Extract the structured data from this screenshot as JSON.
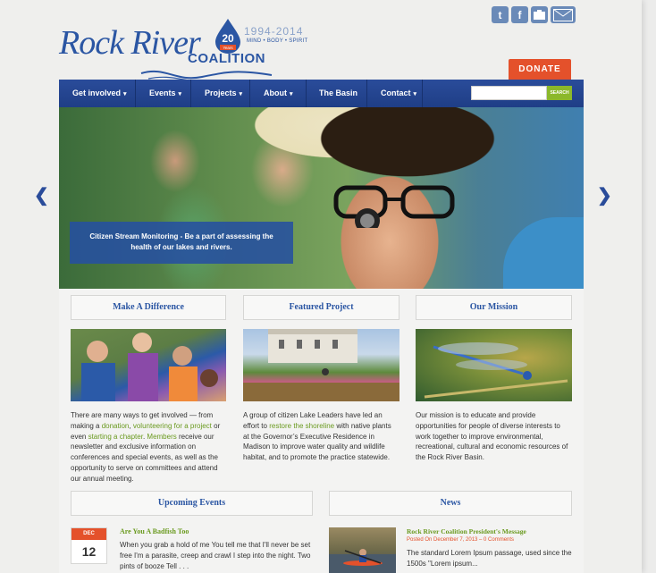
{
  "brand": {
    "script_name": "Rock River",
    "anniversary_number": "20",
    "anniversary_label": "Years",
    "years": "1994-2014",
    "motto": "MIND • BODY • SPIRIT",
    "coalition": "COALITION",
    "colors": {
      "blue": "#2b56a3",
      "orange": "#e4512b",
      "green": "#6a9a1f"
    }
  },
  "social": {
    "twitter_glyph": "t",
    "facebook_glyph": "f",
    "icons": [
      "twitter-icon",
      "facebook-icon",
      "flickr-icon",
      "mail-icon"
    ]
  },
  "donate_label": "DONATE",
  "nav": {
    "items": [
      {
        "label": "Get involved",
        "caret": "▾"
      },
      {
        "label": "Events",
        "caret": "▾"
      },
      {
        "label": "Projects",
        "caret": "▾"
      },
      {
        "label": "About",
        "caret": "▾"
      },
      {
        "label": "The Basin",
        "caret": ""
      },
      {
        "label": "Contact",
        "caret": "▾"
      }
    ],
    "search_placeholder": "",
    "search_button": "SEARCH"
  },
  "hero": {
    "caption": "Citizen Stream Monitoring - Be a part of assessing the health of our lakes and rivers.",
    "prev_arrow": "❮",
    "next_arrow": "❯"
  },
  "columns": [
    {
      "heading": "Make A Difference",
      "text_parts": {
        "t1": "There are many ways to get involved — from making a ",
        "l1": "donation",
        "t2": ", ",
        "l2": "volunteering for a project",
        "t3": " or even ",
        "l3": "starting a chapter",
        "t4": ". ",
        "l4": "Members",
        "t5": " receive our newsletter and exclusive information on conferences and special events, as well as the opportunity to serve on committees and attend our annual meeting."
      }
    },
    {
      "heading": "Featured Project",
      "text_parts": {
        "t1": "A group of citizen Lake Leaders have led an effort to ",
        "l1": "restore the shoreline",
        "t2": " with native plants at the Governor’s Executive Residence in Madison to improve water quality and wildlife habitat, and to promote the practice statewide."
      }
    },
    {
      "heading": "Our Mission",
      "text": "Our mission is to educate and provide opportunities for people of diverse interests to work together to improve environmental, recreational, cultural and economic resources of the Rock River Basin."
    }
  ],
  "events": {
    "heading": "Upcoming Events",
    "month": "DEC",
    "day": "12",
    "title": "Are You A Badfish Too",
    "text": "When you grab a hold of me You tell me that I'll never be set free I'm a parasite, creep and crawl I step into the night. Two pints of booze Tell . . ."
  },
  "news": {
    "heading": "News",
    "title": "Rock River Coalition President's Message",
    "meta": "Posted On December 7, 2013 – 0 Comments",
    "text": "The standard Lorem Ipsum passage, used since the 1500s \"Lorem ipsum..."
  }
}
